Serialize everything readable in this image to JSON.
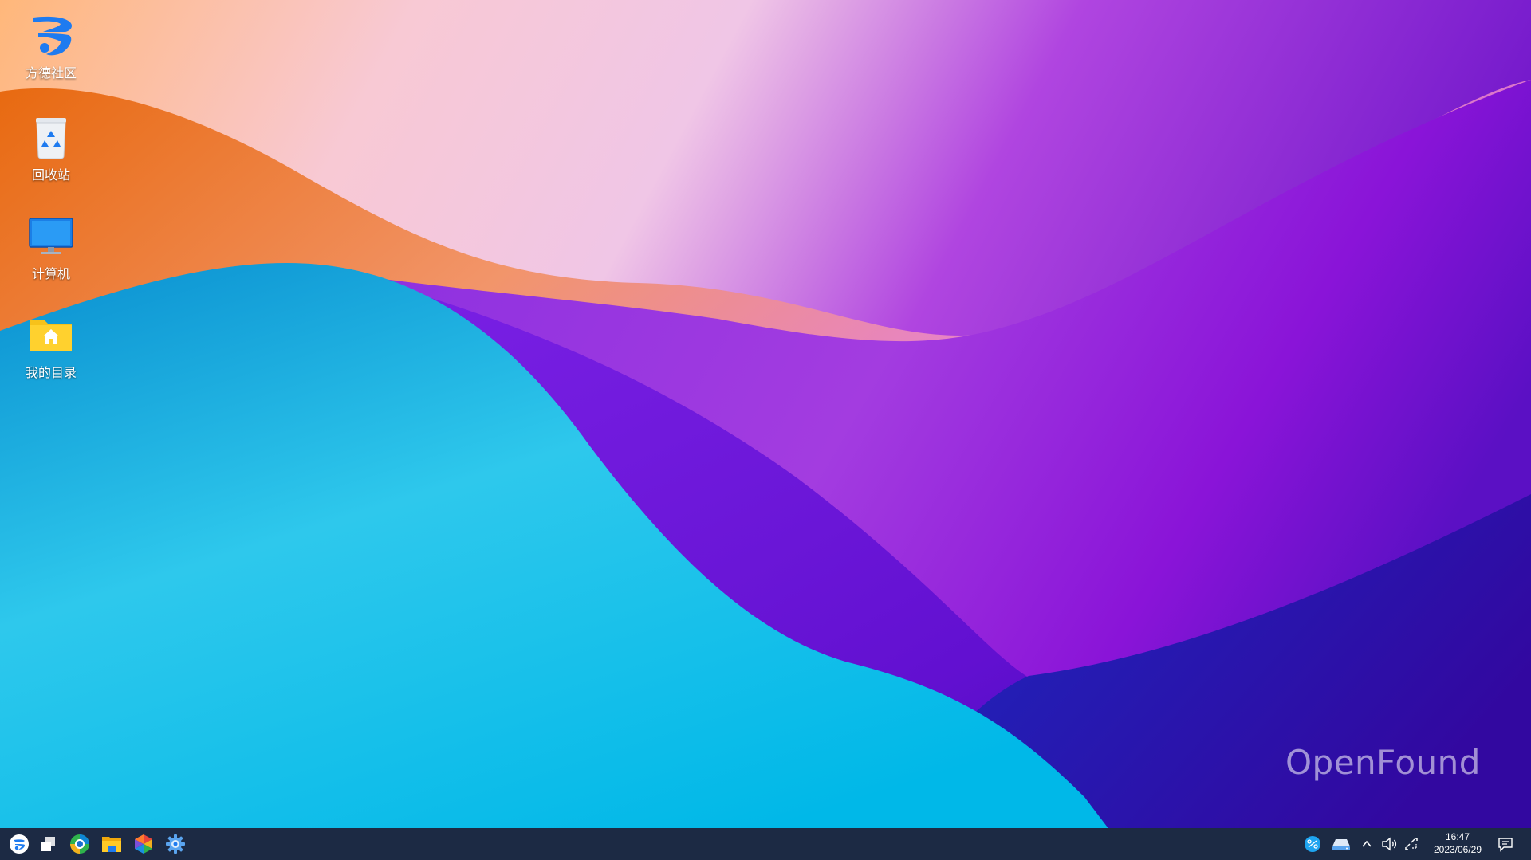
{
  "desktop": {
    "icons": [
      {
        "label": "方德社区",
        "icon": "fangde-logo-icon"
      },
      {
        "label": "回收站",
        "icon": "recycle-bin-icon"
      },
      {
        "label": "计算机",
        "icon": "computer-monitor-icon"
      },
      {
        "label": "我的目录",
        "icon": "home-folder-icon"
      }
    ],
    "watermark": "OpenFound"
  },
  "taskbar": {
    "apps": [
      {
        "icon": "start-menu-icon"
      },
      {
        "icon": "multitask-view-icon"
      },
      {
        "icon": "browser-icon"
      },
      {
        "icon": "file-manager-icon"
      },
      {
        "icon": "app-store-icon"
      },
      {
        "icon": "settings-gear-icon"
      }
    ],
    "tray": [
      {
        "icon": "input-method-icon"
      },
      {
        "icon": "network-drive-icon"
      },
      {
        "icon": "chevron-up-icon"
      },
      {
        "icon": "volume-icon"
      },
      {
        "icon": "network-disconnected-icon"
      }
    ],
    "clock": {
      "time": "16:47",
      "date": "2023/06/29"
    },
    "notification_icon": "notification-center-icon"
  },
  "colors": {
    "taskbar": "#1c2a44",
    "accent": "#1e7bf0",
    "folder": "#f7c21a"
  }
}
